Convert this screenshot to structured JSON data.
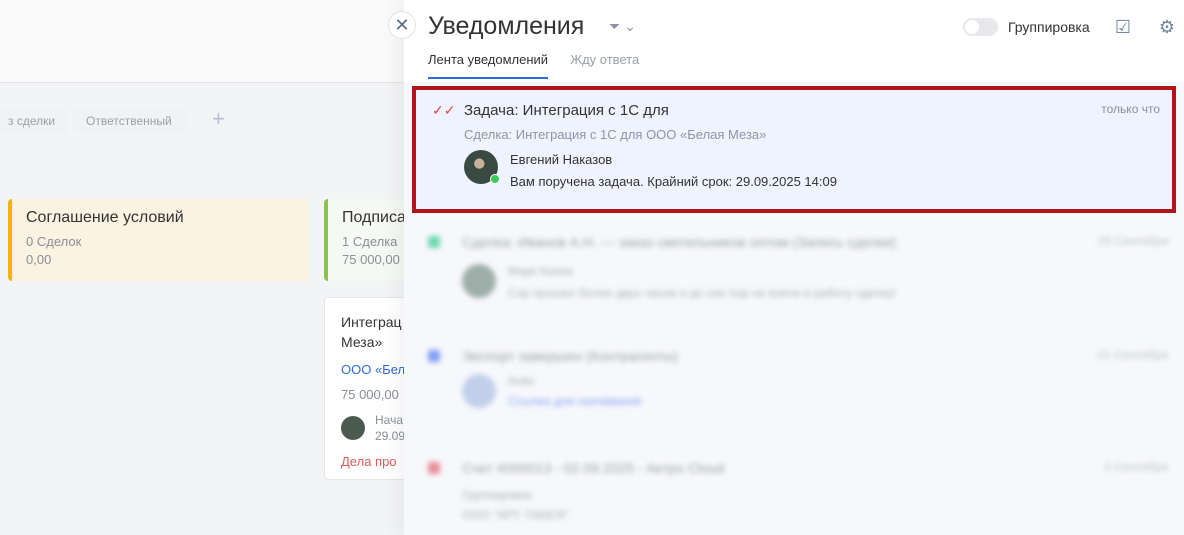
{
  "background": {
    "filters": [
      "з сделки",
      "Ответственный"
    ],
    "stages": [
      {
        "name": "Соглашение условий",
        "count": "0 Сделок",
        "sum": "0,00"
      },
      {
        "name": "Подписа",
        "count": "1 Сделка",
        "sum": "75 000,00"
      }
    ],
    "deal_card": {
      "title": "Интеграц Меза»",
      "company": "ООО «Бел",
      "sum": "75 000,00",
      "person_line1": "Нача",
      "person_line2": "29.09",
      "due": "Дела про"
    }
  },
  "panel": {
    "title": "Уведомления",
    "group_label": "Группировка",
    "tabs": [
      "Лента уведомлений",
      "Жду ответа"
    ],
    "notification": {
      "title": "Задача: Интеграция с 1С для",
      "time": "только что",
      "subtitle": "Сделка: Интеграция с 1С для ООО «Белая Меза»",
      "author": "Евгений Наказов",
      "text": "Вам поручена задача. Крайний срок: 29.09.2025 14:09"
    },
    "blurred_items": [
      {
        "title": "Сделка: Иванов А.Н. — заказ светильников оптом (Запись сделки)",
        "date": "29 Сентября",
        "author": "Марк Казюк",
        "text": "Сэр прошел более двух часов и до сих пор не взяли в работу сделку!"
      },
      {
        "title": "Экспорт завершен (Контрагенты)",
        "date": "01 Сентября",
        "author": "Avito",
        "text": "Ссылка для скачивания"
      },
      {
        "title": "Счет #000013 - 02.09.2025 - Актро Cloud",
        "date": "2 Сентября",
        "author": "Группировка",
        "text": "ООО \"АРТ-ТАБЕЯ\""
      }
    ]
  }
}
